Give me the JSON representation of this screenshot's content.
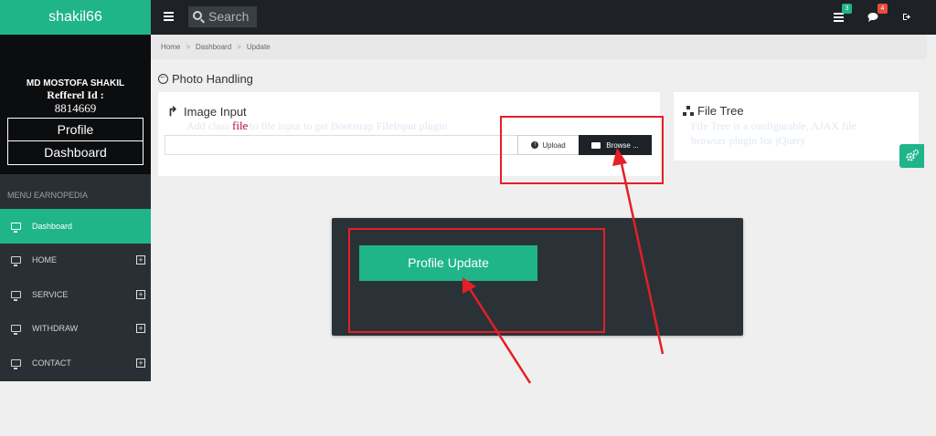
{
  "sidebar": {
    "brand": "shakil66",
    "user_name": "MD MOSTOFA SHAKIL",
    "referral_label": "Refferel Id :",
    "referral_id": "8814669",
    "profile_button": "Profile",
    "dashboard_button": "Dashboard",
    "menu_header": "MENU EARNOPEDIA",
    "items": [
      {
        "label": "Dashboard",
        "active": true
      },
      {
        "label": "HOME"
      },
      {
        "label": "SERVICE"
      },
      {
        "label": "WITHDRAW"
      },
      {
        "label": "CONTACT"
      }
    ],
    "plus_glyph": "+"
  },
  "topbar": {
    "search_placeholder": "Search",
    "badges": {
      "tasks": "3",
      "messages": "4"
    },
    "badge_colors": {
      "tasks": "#1fb48a",
      "messages": "#e74c3c"
    }
  },
  "breadcrumb": {
    "items": [
      "Home",
      "Dashboard",
      "Update"
    ],
    "separator": ">"
  },
  "page": {
    "title": "Photo Handling"
  },
  "image_card": {
    "title": "Image Input",
    "ghost_text": "Add class file to file input to get Bootstrap FileInput plugin",
    "file_label": "file",
    "upload_label": "Upload",
    "browse_label": "Browse ..."
  },
  "tree_card": {
    "title": "File Tree",
    "ghost_text_1": "File Tree is a configurable, AJAX file",
    "ghost_text_2": "browser plugin for jQuery"
  },
  "panel": {
    "button_label": "Profile Update"
  },
  "colors": {
    "accent": "#1fb48a",
    "annotation": "#e41f26",
    "dark": "#1e2226"
  }
}
